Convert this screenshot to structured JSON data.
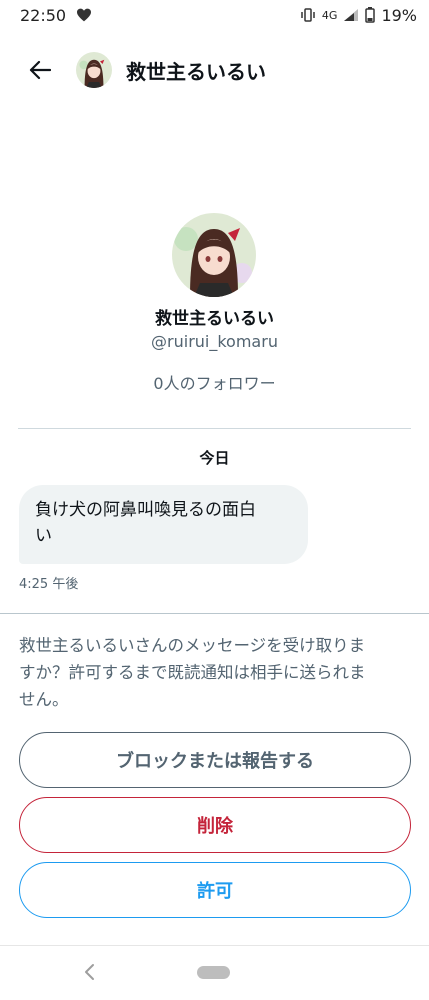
{
  "status_bar": {
    "time": "22:50",
    "network": "4G",
    "battery": "19%",
    "icons": [
      "heart-icon",
      "vibrate-icon",
      "signal-icon",
      "battery-icon"
    ]
  },
  "header": {
    "title": "救世主るいるい",
    "back_icon": "arrow-left-icon"
  },
  "profile": {
    "name": "救世主るいるい",
    "handle": "@ruirui_komaru",
    "followers": "0人のフォロワー"
  },
  "conversation": {
    "date_label": "今日",
    "messages": [
      {
        "text_line1": "負け犬の阿鼻叫喚見るの面白",
        "text_line2": "い",
        "time": "4:25 午後"
      }
    ]
  },
  "request": {
    "prompt_line1": "救世主るいるいさんのメッセージを受け取りま",
    "prompt_line2": "すか？許可するまで既読通知は相手に送られま",
    "prompt_line3": "せん。"
  },
  "actions": {
    "block_label": "ブロックまたは報告する",
    "delete_label": "削除",
    "allow_label": "許可"
  },
  "colors": {
    "primary_text": "#0f1419",
    "secondary_text": "#536471",
    "danger": "#c4243a",
    "accent": "#1d9bf0",
    "bubble_bg": "#eff3f4"
  }
}
